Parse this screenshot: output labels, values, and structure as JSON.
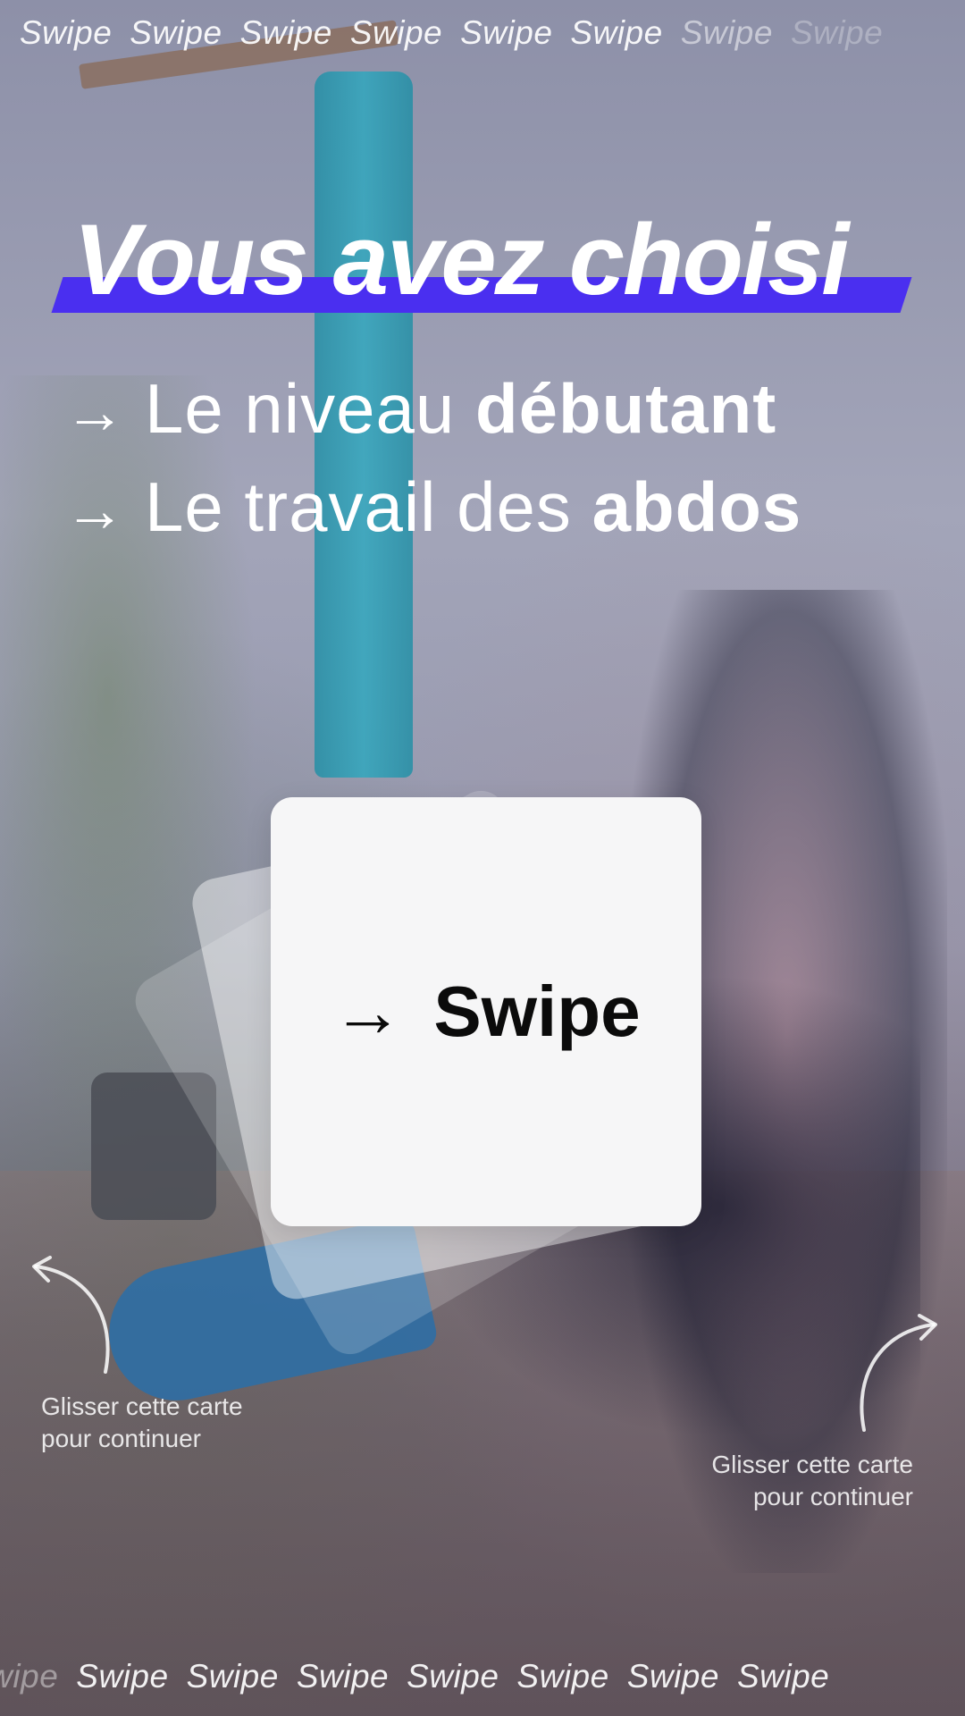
{
  "ticker": {
    "top": [
      "Swipe",
      "Swipe",
      "Swipe",
      "Swipe",
      "Swipe",
      "Swipe",
      "Swipe",
      "Swipe"
    ],
    "bottom": [
      "Swipe",
      "Swipe",
      "Swipe",
      "Swipe",
      "Swipe",
      "Swipe",
      "Swipe",
      "Swipe"
    ]
  },
  "headline": "Vous avez choisi",
  "choices": [
    {
      "light": "Le niveau ",
      "bold": "débutant"
    },
    {
      "light": "Le travail des ",
      "bold": "abdos"
    }
  ],
  "card": {
    "arrow": "→",
    "label": "Swipe"
  },
  "hints": {
    "left": [
      "Glisser cette carte",
      "pour continuer"
    ],
    "right": [
      "Glisser cette carte",
      "pour continuer"
    ]
  },
  "colors": {
    "highlight": "#4a2ff0",
    "card": "#f6f6f7",
    "text": "#ffffff"
  }
}
